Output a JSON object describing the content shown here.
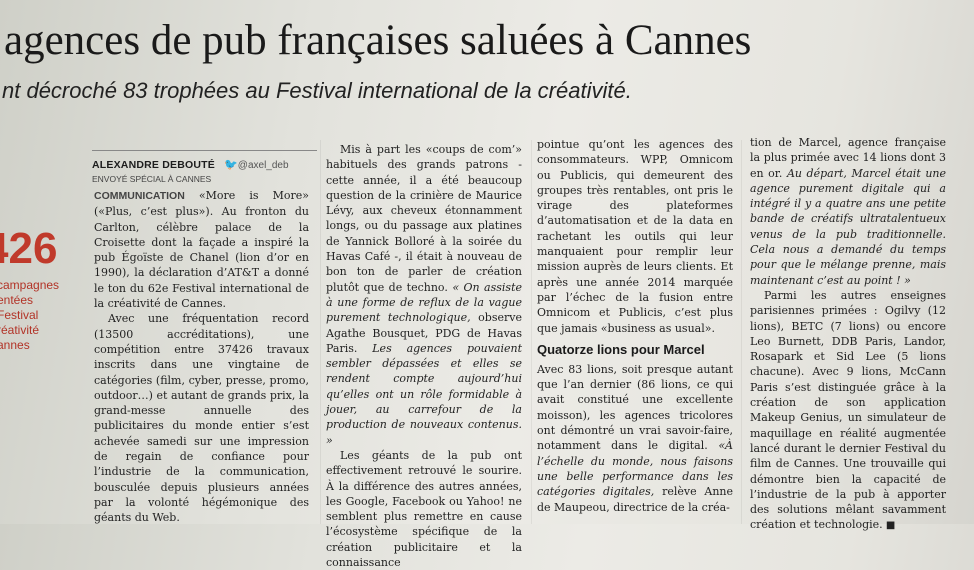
{
  "headline": "agences de pub françaises saluées à Cannes",
  "subhead": "nt décroché 83 trophées au Festival international de la créativité.",
  "sidebar": {
    "number": "426",
    "lines": [
      "campagnes",
      "entées",
      "Festival",
      "réativité",
      "annes"
    ]
  },
  "byline": {
    "author": "ALEXANDRE DEBOUTÉ",
    "twitter": "@axel_deb",
    "dateline": "ENVOYÉ SPÉCIAL À CANNES"
  },
  "article": {
    "col1": {
      "kicker": "COMMUNICATION",
      "p1": " «More is More» («Plus, c’est plus»). Au fronton du Carlton, célèbre palace de la Croisette dont la façade a inspiré la pub Égoïste de Chanel (lion d’or en 1990), la déclaration d’AT&T a donné le ton du 62e Festival international de la créativité de Cannes.",
      "p2": "Avec une fréquentation record (13500 accréditations), une compétition entre 37426 travaux inscrits dans une vingtaine de catégories (film, cyber, presse, promo, outdoor…) et autant de grands prix, la grand-messe annuelle des publicitaires du monde entier s’est achevée samedi sur une impression de regain de confiance pour l’industrie de la communication, bousculée depuis plusieurs années par la volonté hégémonique des géants du Web."
    },
    "col2": {
      "p1": "Mis à part les «coups de com’» habituels des grands patrons - cette année, il a été beaucoup question de la crinière de Maurice Lévy, aux cheveux étonnamment longs, ou du passage aux platines de Yannick Bolloré à la soirée du Havas Café -, il était à nouveau de bon ton de parler de création plutôt que de techno.",
      "p1_quote": " « On assiste à une forme de reflux de la vague purement technologique,",
      "p1_tail": " observe Agathe Bousquet, PDG de Havas Paris.",
      "p1_quote2": " Les agences pouvaient sembler dépassées et elles se rendent compte aujourd’hui qu’elles ont un rôle formidable à jouer, au carrefour de la production de nouveaux contenus. »",
      "p2": "Les géants de la pub ont effectivement retrouvé le sourire. À la différence des autres années, les Google, Facebook ou Yahoo! ne semblent plus remettre en cause l’écosystème spécifique de la création publicitaire et la connaissance"
    },
    "col3": {
      "p1": "pointue qu’ont les agences des consommateurs. WPP, Omnicom ou Publicis, qui demeurent des groupes très rentables, ont pris le virage des plateformes d’automatisation et de la data en rachetant les outils qui leur manquaient pour remplir leur mission auprès de leurs clients. Et après une année 2014 marquée par l’échec de la fusion entre Omnicom et Publicis, c’est plus que jamais «business as usual».",
      "heading": "Quatorze lions pour Marcel",
      "p2": "Avec 83 lions, soit presque autant que l’an dernier (86 lions, ce qui avait constitué une excellente moisson), les agences tricolores ont démontré un vrai savoir-faire, notamment dans le digital.",
      "p2_quote": " «À l’échelle du monde, nous faisons une belle performance dans les catégories digitales,",
      "p2_tail": " relève Anne de Maupeou, directrice de la créa-"
    },
    "col4": {
      "p1": "tion de Marcel, agence française la plus primée avec 14 lions dont 3 en or.",
      "p1_quote": " Au départ, Marcel était une agence purement digitale qui a intégré il y a quatre ans une petite bande de créatifs ultratalentueux venus de la pub traditionnelle. Cela nous a demandé du temps pour que le mélange prenne, mais maintenant c’est au point ! »",
      "p2": "Parmi les autres enseignes parisiennes primées : Ogilvy (12 lions), BETC (7 lions) ou encore Leo Burnett, DDB Paris, Landor, Rosapark et Sid Lee (5 lions chacune). Avec 9 lions, McCann Paris s’est distinguée grâce à la création de son application Makeup Genius, un simulateur de maquillage en réalité augmentée lancé durant le dernier Festival du film de Cannes. Une trouvaille qui démontre bien la capacité de l’industrie de la pub à apporter des solutions mêlant savamment création et technologie.",
      "end": " ■"
    }
  }
}
